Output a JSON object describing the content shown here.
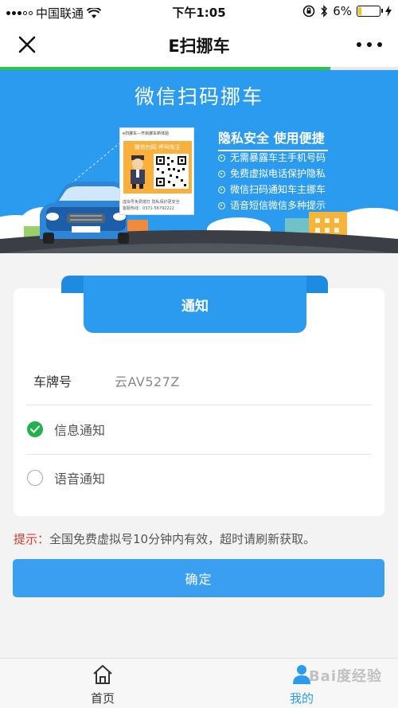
{
  "status_bar": {
    "carrier": "中国联通",
    "time": "下午1:05",
    "battery": "6%",
    "battery_level": 0.06
  },
  "nav": {
    "title": "E扫挪车"
  },
  "page_progress": 0.83,
  "banner": {
    "title": "微信扫码挪车",
    "headline": "隐私安全  使用便捷",
    "points": [
      "无需暴露车主手机号码",
      "免费虚拟电话保护隐私",
      "微信扫码通知车主挪车",
      "语音短信微信多种提示"
    ],
    "sticker_header": "e扫挪车—开启挪车新体验",
    "sticker_slogan": "微信扫码  呼叫车主",
    "sticker_footer_1": "虚拟号免费拨打  隐私保护更安全",
    "sticker_footer_2": "客服热线：0371-56792222"
  },
  "card": {
    "ribbon_title": "通知",
    "plate_label": "车牌号",
    "plate_value": "云AV527Z",
    "options": [
      {
        "label": "信息通知",
        "checked": true
      },
      {
        "label": "语音通知",
        "checked": false
      }
    ]
  },
  "tip": {
    "label": "提示：",
    "text": "全国免费虚拟号10分钟内有效，超时请刷新获取。"
  },
  "confirm_label": "确定",
  "tabbar": {
    "home_label": "首页",
    "mine_label": "我的",
    "active": "mine"
  },
  "watermark": "Bai度经验"
}
